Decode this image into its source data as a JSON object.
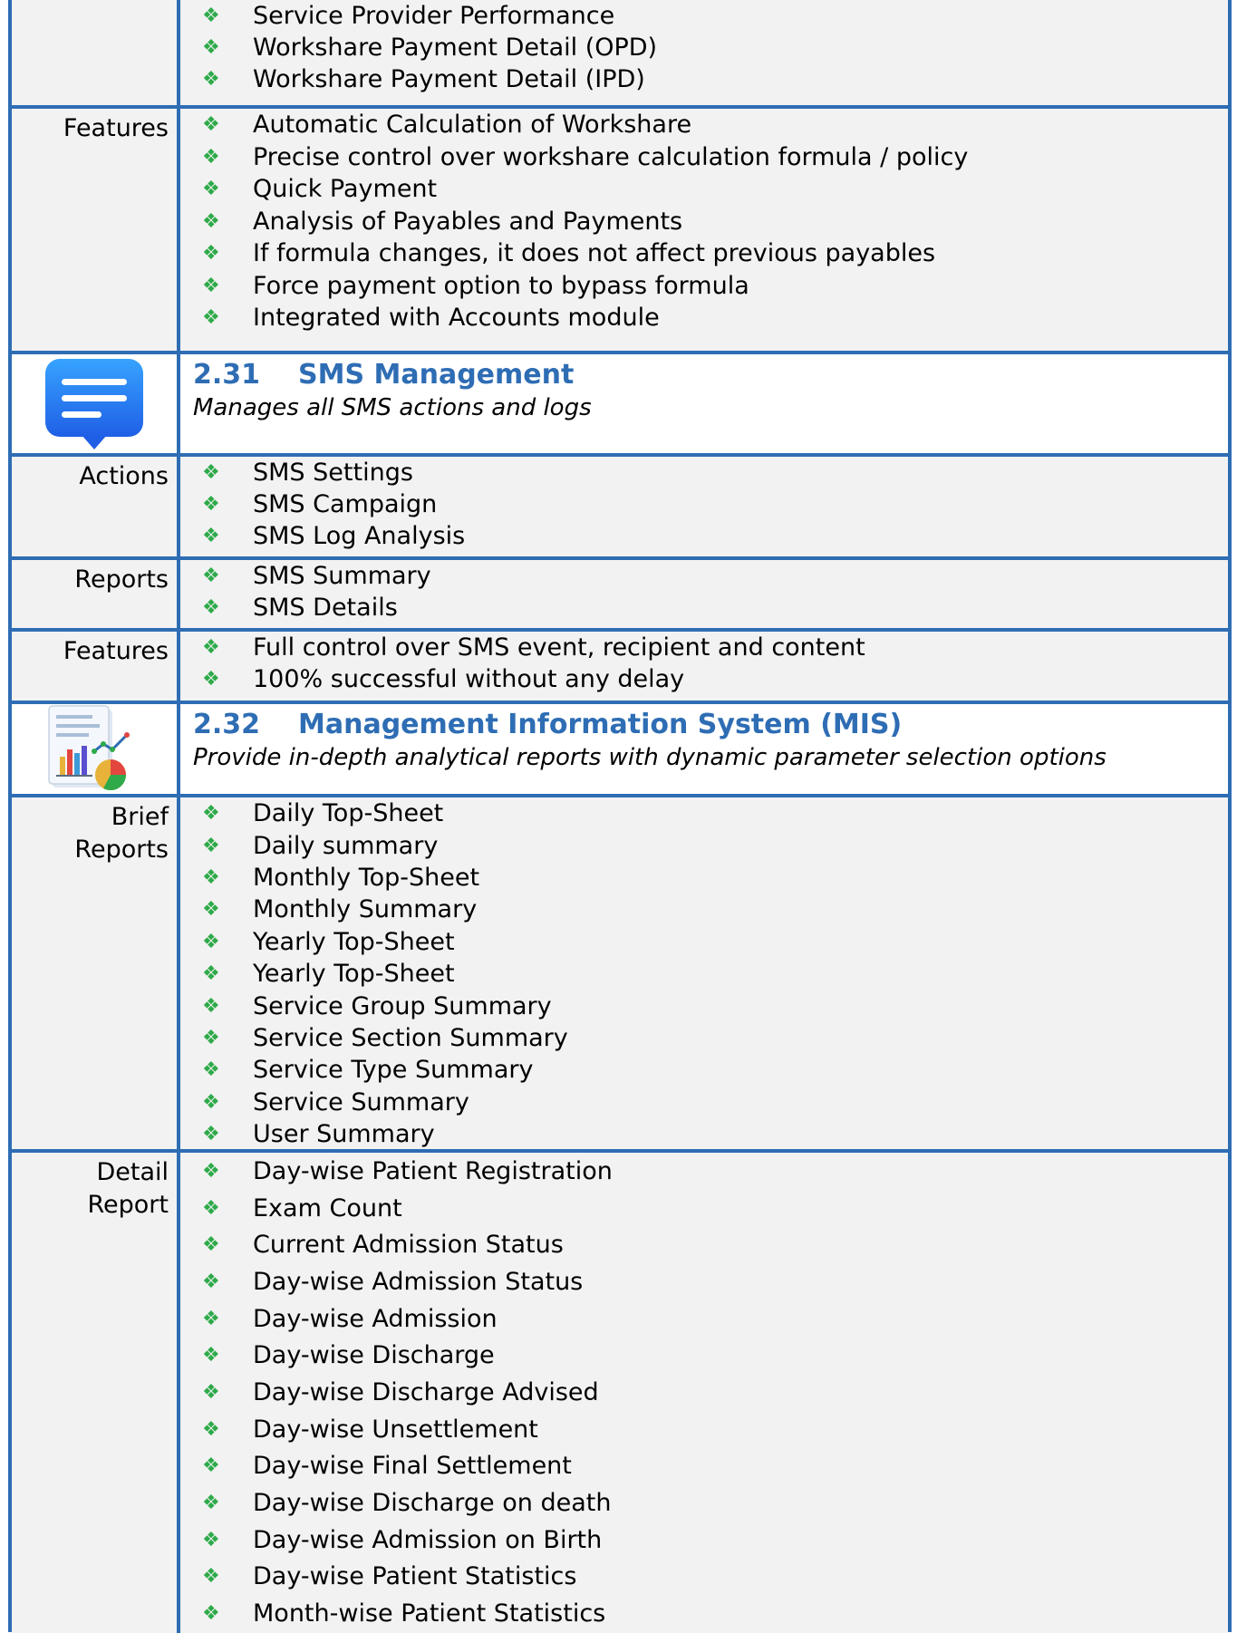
{
  "row_top": {
    "items": [
      "Service Provider Performance",
      "Workshare Payment Detail (OPD)",
      "Workshare Payment Detail (IPD)"
    ]
  },
  "features_1": {
    "label": "Features",
    "items": [
      "Automatic Calculation of Workshare",
      "Precise control over workshare calculation formula / policy",
      "Quick Payment",
      "Analysis of Payables and Payments",
      "If formula changes, it does not affect previous payables",
      "Force payment option to bypass formula",
      "Integrated with Accounts module"
    ]
  },
  "sms": {
    "number": "2.31",
    "title": "SMS Management",
    "subtitle": "Manages all SMS actions and logs",
    "icon": "chat-message-icon"
  },
  "sms_actions": {
    "label": "Actions",
    "items": [
      "SMS Settings",
      "SMS Campaign",
      "SMS Log Analysis"
    ]
  },
  "sms_reports": {
    "label": "Reports",
    "items": [
      "SMS Summary",
      "SMS Details"
    ]
  },
  "sms_features": {
    "label": "Features",
    "items": [
      "Full control over SMS event, recipient and content",
      "100% successful without any delay"
    ]
  },
  "mis": {
    "number": "2.32",
    "title": "Management Information System (MIS)",
    "subtitle": "Provide in-depth analytical reports with dynamic parameter selection options",
    "icon": "report-chart-icon"
  },
  "brief_reports": {
    "label_line1": "Brief",
    "label_line2": "Reports",
    "items": [
      "Daily Top-Sheet",
      "Daily summary",
      "Monthly Top-Sheet",
      "Monthly Summary",
      "Yearly Top-Sheet",
      "Yearly Top-Sheet",
      "Service Group Summary",
      "Service Section Summary",
      "Service Type Summary",
      "Service Summary",
      "User Summary"
    ]
  },
  "detail_report": {
    "label_line1": "Detail",
    "label_line2": "Report",
    "items": [
      "Day-wise Patient Registration",
      "Exam Count",
      "Current Admission Status",
      "Day-wise Admission Status",
      "Day-wise Admission",
      "Day-wise Discharge",
      "Day-wise Discharge Advised",
      "Day-wise Unsettlement",
      "Day-wise Final Settlement",
      "Day-wise Discharge on death",
      "Day-wise Admission on Birth",
      "Day-wise Patient Statistics",
      "Month-wise Patient Statistics"
    ]
  },
  "colors": {
    "border": "#2e6db4",
    "heading": "#2e6db4",
    "bullet": "#2eaa4a",
    "row_bg": "#f2f2f2"
  },
  "bullet_glyph": "❖"
}
